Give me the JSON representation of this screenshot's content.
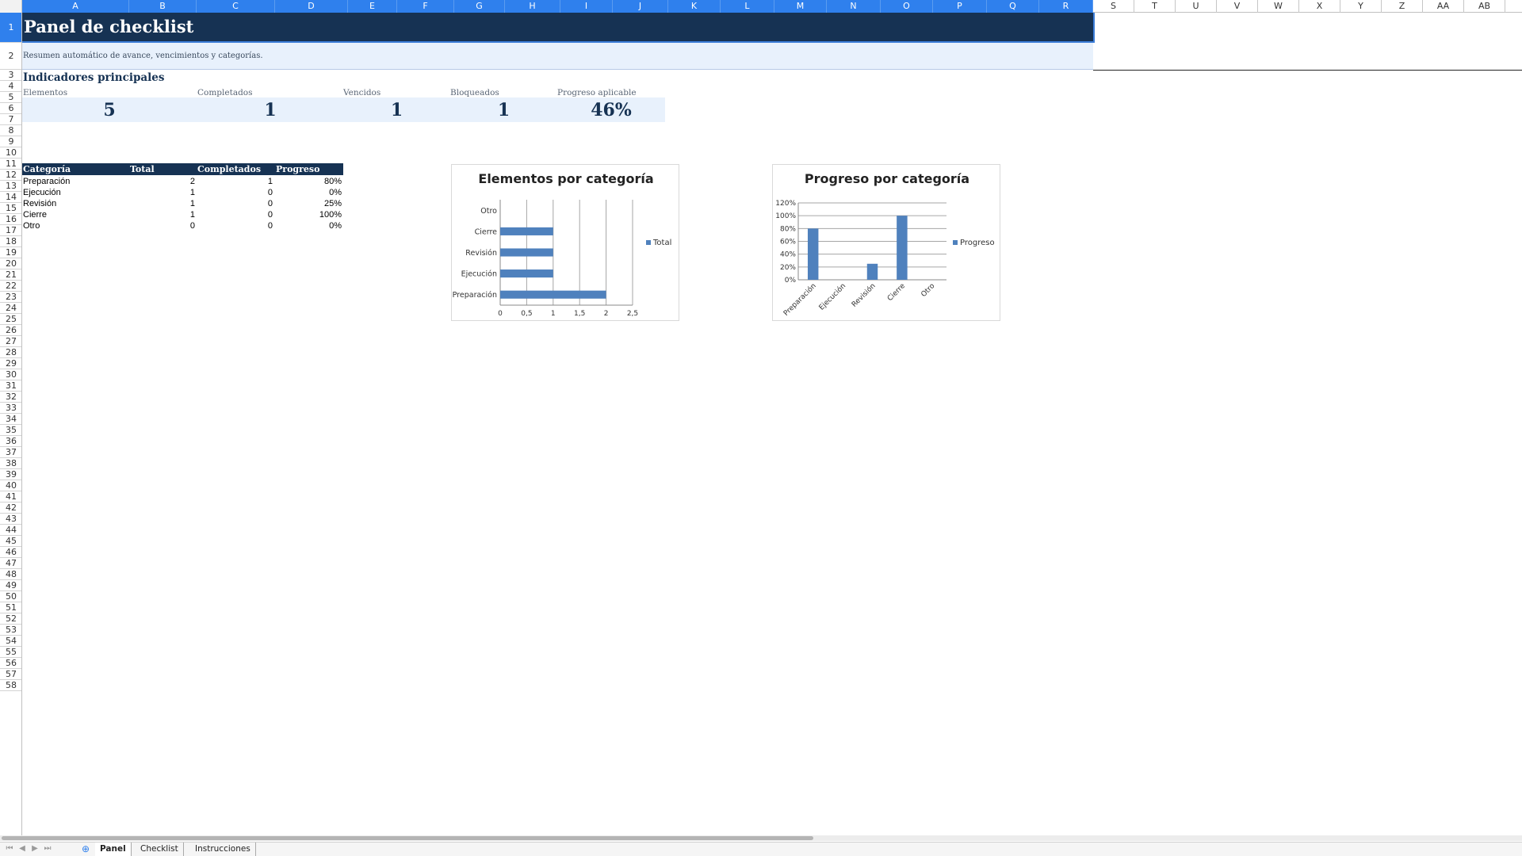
{
  "columns": [
    "A",
    "B",
    "C",
    "D",
    "E",
    "F",
    "G",
    "H",
    "I",
    "J",
    "K",
    "L",
    "M",
    "N",
    "O",
    "P",
    "Q",
    "R",
    "S",
    "T",
    "U",
    "V",
    "W",
    "X",
    "Y",
    "Z",
    "AA",
    "AB"
  ],
  "rows_visible": 57,
  "title": "Panel de checklist",
  "subtitle": "Resumen automático de avance, vencimientos y categorías.",
  "section_title": "Indicadores principales",
  "kpis": [
    {
      "label": "Elementos",
      "value": "5"
    },
    {
      "label": "Completados",
      "value": "1"
    },
    {
      "label": "Vencidos",
      "value": "1"
    },
    {
      "label": "Bloqueados",
      "value": "1"
    },
    {
      "label": "Progreso aplicable",
      "value": "46%"
    }
  ],
  "category_table": {
    "headers": [
      "Categoría",
      "Total",
      "Completados",
      "Progreso"
    ],
    "rows": [
      {
        "categoria": "Preparación",
        "total": "2",
        "completados": "1",
        "progreso": "80%"
      },
      {
        "categoria": "Ejecución",
        "total": "1",
        "completados": "0",
        "progreso": "0%"
      },
      {
        "categoria": "Revisión",
        "total": "1",
        "completados": "0",
        "progreso": "25%"
      },
      {
        "categoria": "Cierre",
        "total": "1",
        "completados": "0",
        "progreso": "100%"
      },
      {
        "categoria": "Otro",
        "total": "0",
        "completados": "0",
        "progreso": "0%"
      }
    ]
  },
  "chart_data": [
    {
      "type": "bar",
      "orientation": "horizontal",
      "title": "Elementos por categoría",
      "categories": [
        "Preparación",
        "Ejecución",
        "Revisión",
        "Cierre",
        "Otro"
      ],
      "series": [
        {
          "name": "Total",
          "values": [
            2,
            1,
            1,
            1,
            0
          ]
        }
      ],
      "xlim": [
        0,
        2.5
      ],
      "ticks": [
        "0",
        "0,5",
        "1",
        "1,5",
        "2",
        "2,5"
      ],
      "tick_values": [
        0,
        0.5,
        1,
        1.5,
        2,
        2.5
      ],
      "grid": true,
      "legend": "right",
      "color": "#4f81bd"
    },
    {
      "type": "bar",
      "orientation": "vertical",
      "title": "Progreso por categoría",
      "categories": [
        "Preparación",
        "Ejecución",
        "Revisión",
        "Cierre",
        "Otro"
      ],
      "series": [
        {
          "name": "Progreso",
          "values": [
            0.8,
            0,
            0.25,
            1.0,
            0
          ]
        }
      ],
      "ylim": [
        0,
        1.2
      ],
      "ticks": [
        "0%",
        "20%",
        "40%",
        "60%",
        "80%",
        "100%",
        "120%"
      ],
      "tick_values": [
        0,
        0.2,
        0.4,
        0.6,
        0.8,
        1.0,
        1.2
      ],
      "grid": true,
      "legend": "right",
      "color": "#4f81bd"
    }
  ],
  "sheets": [
    {
      "name": "Panel",
      "active": true
    },
    {
      "name": "Checklist",
      "active": false
    },
    {
      "name": "Instrucciones",
      "active": false
    }
  ],
  "colors": {
    "header_navy": "#163253",
    "band_light": "#e8f1fc",
    "selection_blue": "#2f80ed",
    "bar_blue": "#4f81bd"
  }
}
